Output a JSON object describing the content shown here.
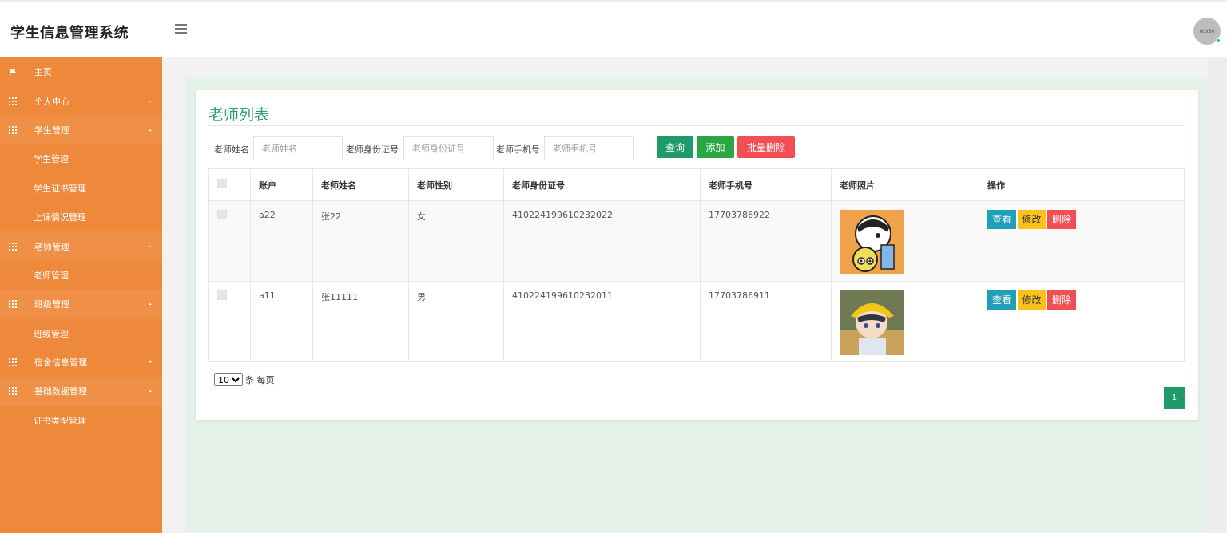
{
  "header": {
    "brand": "学生信息管理系统",
    "avatar_text": "80x80"
  },
  "sidebar": {
    "items": [
      {
        "type": "group",
        "label": "主页",
        "icon": "flag-icon",
        "caret": ""
      },
      {
        "type": "group",
        "label": "个人中心",
        "icon": "grid-icon",
        "caret": "down"
      },
      {
        "type": "group",
        "label": "学生管理",
        "icon": "grid-icon",
        "caret": "up",
        "open": true
      },
      {
        "type": "sub",
        "label": "学生管理"
      },
      {
        "type": "sub",
        "label": "学生证书管理"
      },
      {
        "type": "sub",
        "label": "上课情况管理"
      },
      {
        "type": "group",
        "label": "老师管理",
        "icon": "grid-icon",
        "caret": "up",
        "open": true
      },
      {
        "type": "sub",
        "label": "老师管理"
      },
      {
        "type": "group",
        "label": "班级管理",
        "icon": "grid-icon",
        "caret": "up",
        "open": true
      },
      {
        "type": "sub",
        "label": "班级管理"
      },
      {
        "type": "group",
        "label": "宿舍信息管理",
        "icon": "grid-icon",
        "caret": "down"
      },
      {
        "type": "group",
        "label": "基础数据管理",
        "icon": "grid-icon",
        "caret": "up",
        "open": true
      },
      {
        "type": "sub",
        "label": "证书类型管理"
      }
    ]
  },
  "main": {
    "title": "老师列表",
    "search": {
      "name_label": "老师姓名",
      "name_placeholder": "老师姓名",
      "id_label": "老师身份证号",
      "id_placeholder": "老师身份证号",
      "phone_label": "老师手机号",
      "phone_placeholder": "老师手机号",
      "query_label": "查询",
      "add_label": "添加",
      "batch_delete_label": "批量删除"
    },
    "table": {
      "columns": [
        "账户",
        "老师姓名",
        "老师性别",
        "老师身份证号",
        "老师手机号",
        "老师照片",
        "操作"
      ],
      "rows": [
        {
          "account": "a22",
          "name": "张22",
          "gender": "女",
          "id_number": "410224199610232022",
          "phone": "17703786922",
          "photo": "cartoon-boy-photo"
        },
        {
          "account": "a11",
          "name": "张11111",
          "gender": "男",
          "id_number": "410224199610232011",
          "phone": "17703786911",
          "photo": "anime-boy-photo"
        }
      ],
      "actions": {
        "view": "查看",
        "edit": "修改",
        "delete": "删除"
      }
    },
    "pagination": {
      "page_size": "10",
      "page_size_options": [
        "10"
      ],
      "per_page_label": "条 每页",
      "current_page": "1"
    }
  },
  "colors": {
    "sidebar_bg": "#ee883a",
    "title_green": "#2f9e68",
    "query_btn": "#1f9a6a",
    "add_btn": "#2aa744",
    "danger_btn": "#f24e54",
    "view_btn": "#1f9fb9",
    "edit_btn": "#fbc21a"
  }
}
